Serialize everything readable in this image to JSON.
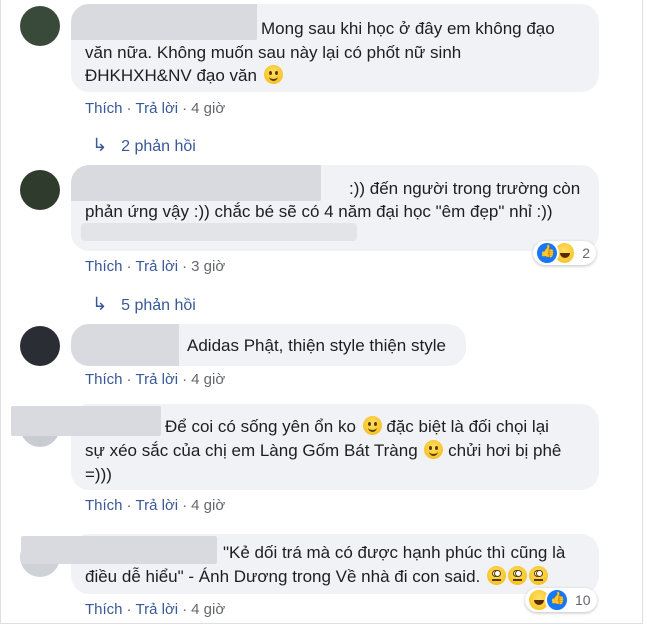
{
  "comments": [
    {
      "text_lines": [
        "Mong sau khi học ở đây em không đạo",
        "văn nữa. Không muốn sau này lại có phốt nữ sinh",
        "ĐHKHXH&NV đạo văn"
      ],
      "actions": {
        "like": "Thích",
        "reply": "Trả lời",
        "time": "4 giờ"
      },
      "replies": "2 phản hồi"
    },
    {
      "text_lines": [
        ":)) đến người trong trường còn",
        "phản ứng vậy :)) chắc bé sẽ có 4 năm đại học \"êm đẹp\" nhỉ :))"
      ],
      "actions": {
        "like": "Thích",
        "reply": "Trả lời",
        "time": "3 giờ"
      },
      "reaction_count": "2",
      "replies": "5 phản hồi"
    },
    {
      "text_lines": [
        "Adidas Phật, thiện style thiện style"
      ],
      "actions": {
        "like": "Thích",
        "reply": "Trả lời",
        "time": "4 giờ"
      }
    },
    {
      "text_lines": [
        "Để coi có sống yên ổn ko",
        "đặc biệt là đối chọi lại",
        "sự xéo sắc của chị em Làng Gốm Bát Tràng",
        "chửi hơi bị phê",
        "=)))"
      ],
      "actions": {
        "like": "Thích",
        "reply": "Trả lời",
        "time": "4 giờ"
      }
    },
    {
      "text_lines": [
        "\"Kẻ dối trá mà có được hạnh phúc thì cũng là",
        "điều dễ hiểu\" - Ánh Dương trong Về nhà đi con said."
      ],
      "actions": {
        "like": "Thích",
        "reply": "Trả lời",
        "time": "4 giờ"
      },
      "reaction_count": "10"
    }
  ],
  "icons": {
    "reply_arrow": "reply-arrow-icon",
    "smile": "smile-emoji-icon",
    "eye_roll": "eye-roll-emoji-icon",
    "like": "like-reaction-icon",
    "haha": "haha-reaction-icon"
  },
  "colors": {
    "link": "#385898",
    "bubble": "#f0f2f5",
    "like": "#1877f2"
  }
}
